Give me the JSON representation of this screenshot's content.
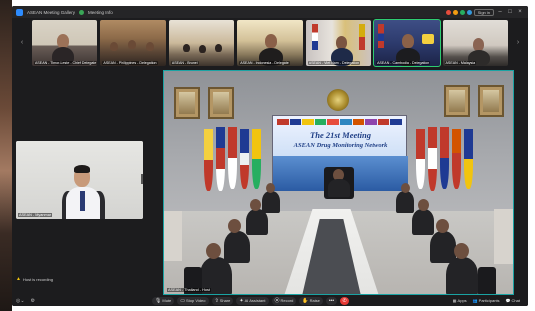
{
  "window": {
    "title": "ASEAN Meeting Gallery",
    "subtitle": "Meeting Info",
    "signin_label": "Sign in"
  },
  "gallery": {
    "tiles": [
      {
        "label": "ASEAN - Timor-Leste - Chief Delegate"
      },
      {
        "label": "ASEAN - Philippines - Delegation"
      },
      {
        "label": "ASEAN - Brunei"
      },
      {
        "label": "ASEAN - Indonesia - Delegate"
      },
      {
        "label": "ASEAN - Viet Nam - Delegation"
      },
      {
        "label": "ASEAN - Cambodia - Delegation"
      },
      {
        "label": "ASEAN - Malaysia"
      }
    ],
    "next_icon": "chevron-right-icon"
  },
  "selfview": {
    "label": "ASEAN - Myanmar"
  },
  "main": {
    "banner_title": "The 21st Meeting",
    "banner_subtitle": "ASEAN Drug Monitoring Network",
    "speaker_label": "ASEAN - Thailand - Host"
  },
  "toast": {
    "text": "Host is recording"
  },
  "toolbar": {
    "mute_label": "Mute",
    "video_label": "Stop Video",
    "share_label": "Share",
    "ai_label": "AI Assistant",
    "record_label": "Record",
    "react_label": "Raise",
    "apps_label": "Apps",
    "participants_label": "Participants",
    "chat_label": "Chat"
  },
  "colors": {
    "active_speaker": "#1aa3a3",
    "end_button": "#e53935",
    "brand": "#2d8cff"
  }
}
